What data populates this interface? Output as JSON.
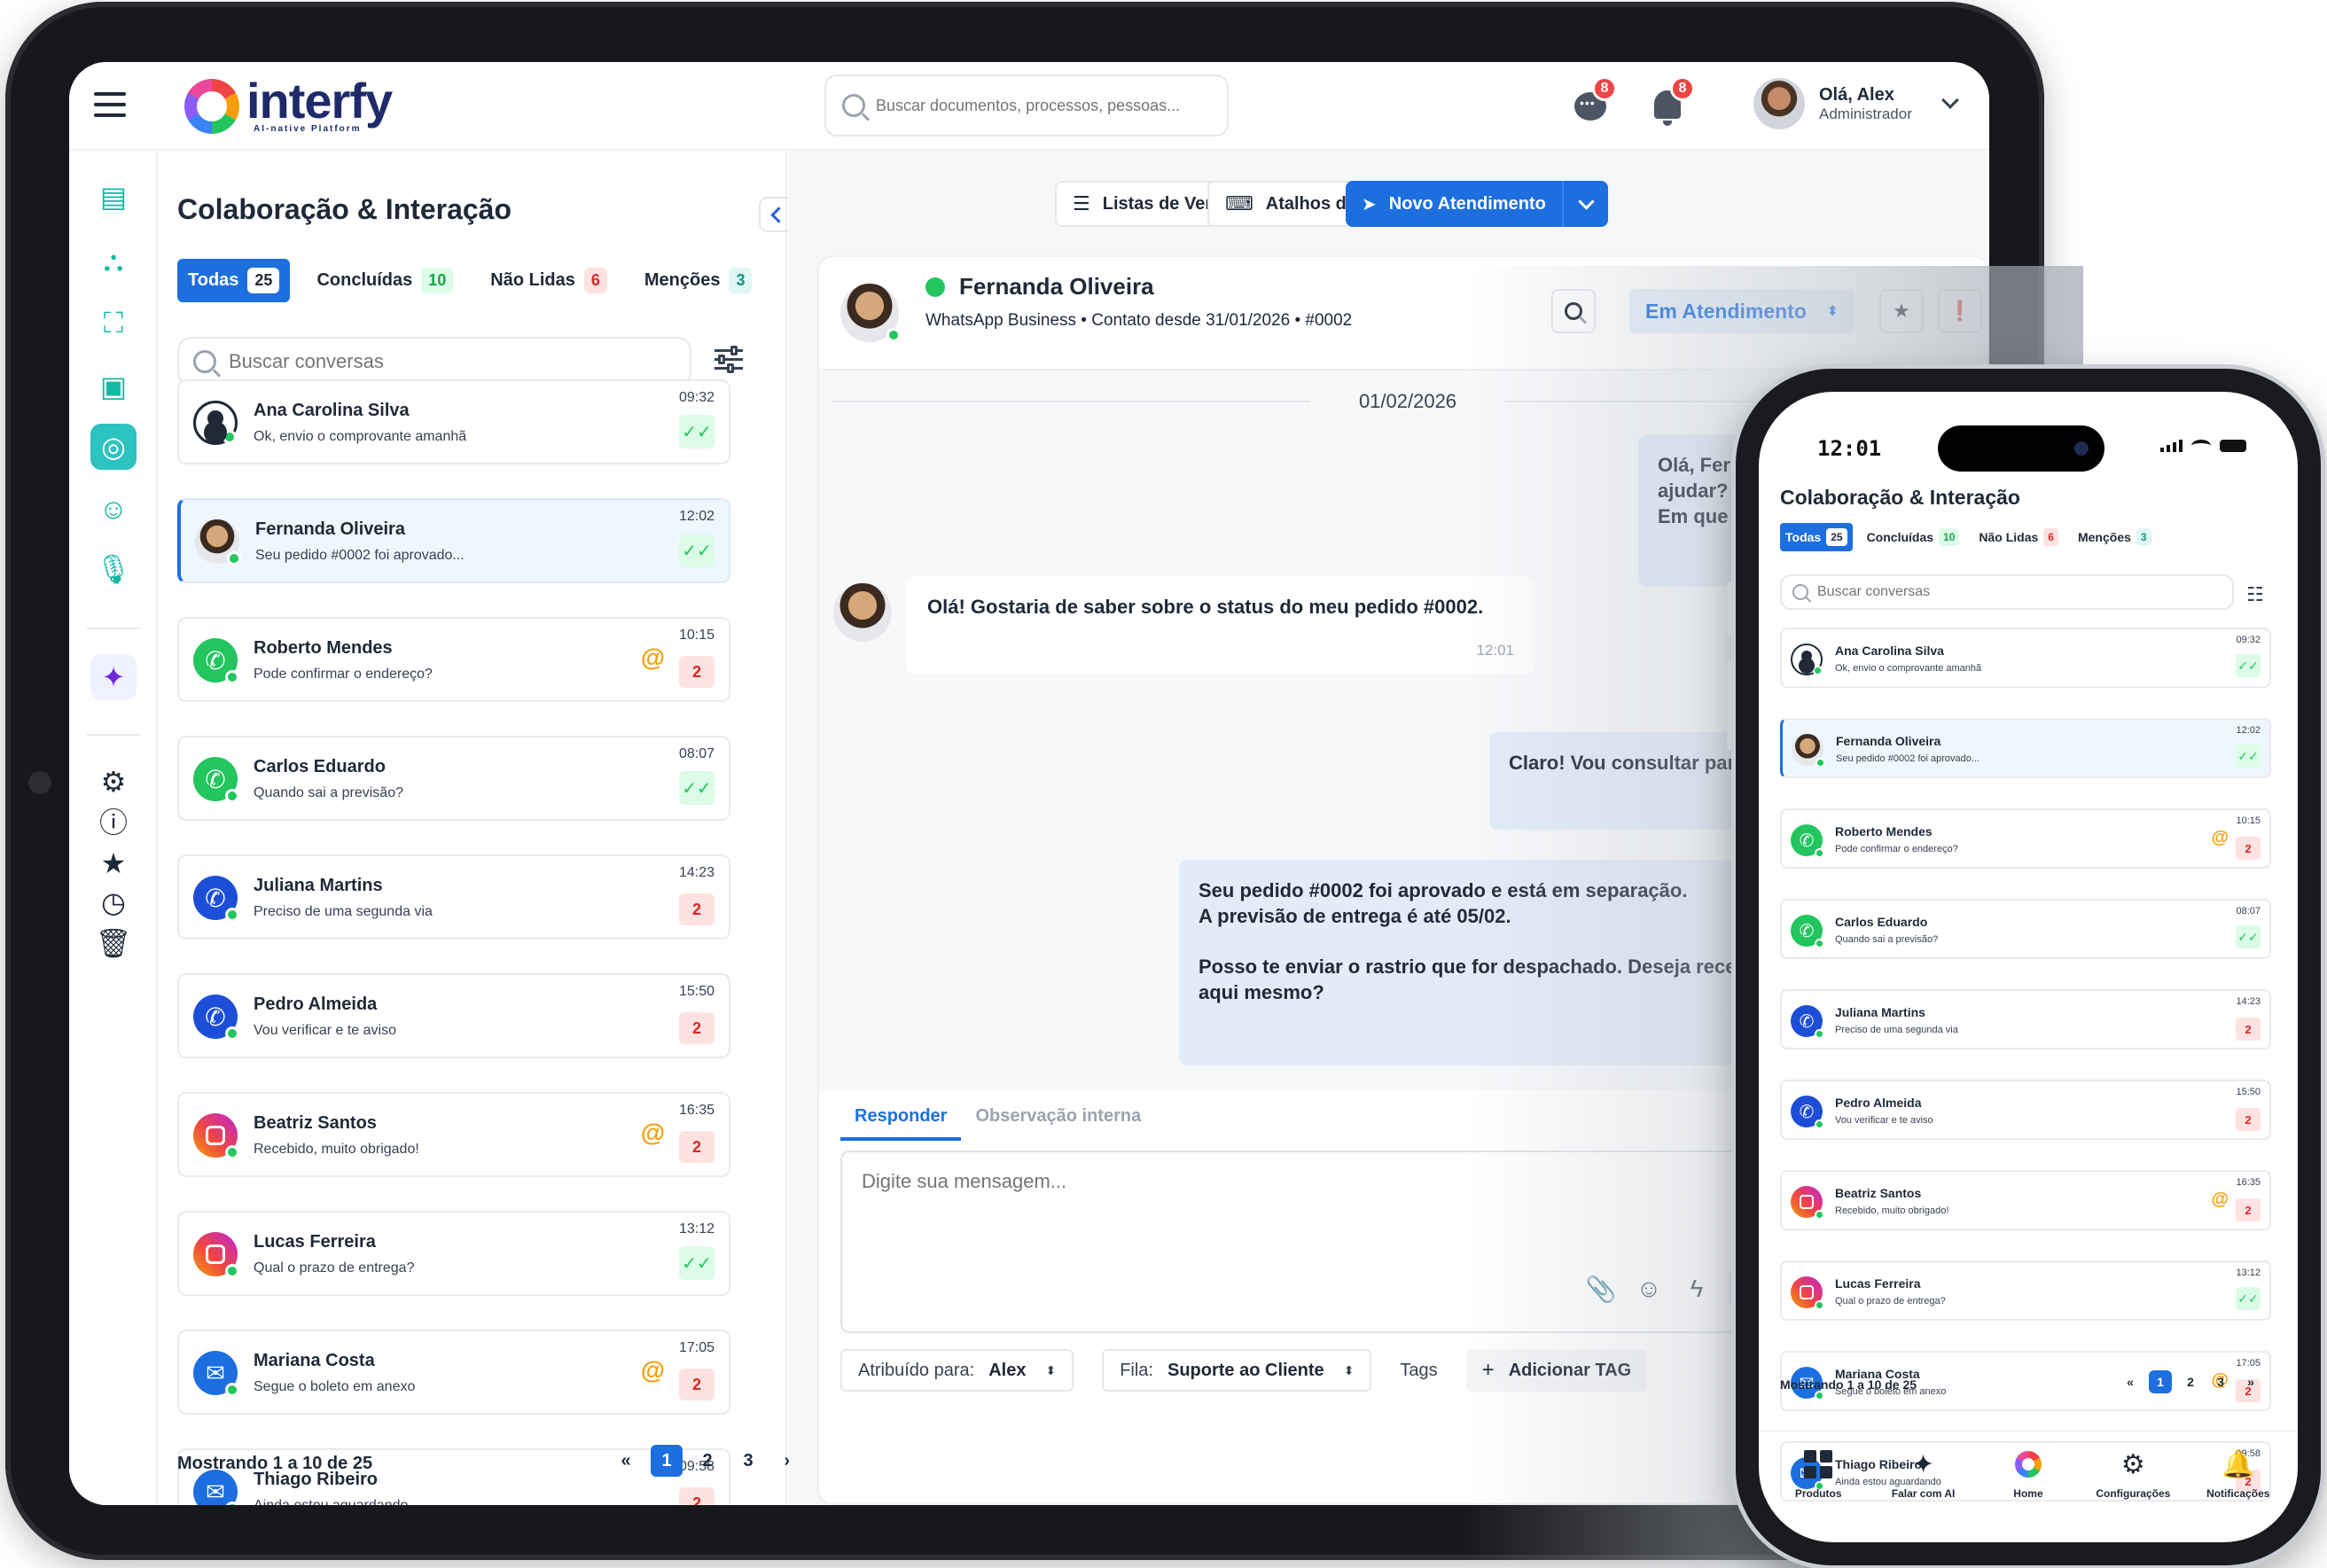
{
  "app": {
    "logo_name": "interfy",
    "logo_tagline": "AI-native Platform",
    "search_placeholder": "Buscar documentos, processos, pessoas...",
    "chat_badge": "8",
    "notif_badge": "8",
    "user_greeting": "Olá, Alex",
    "user_role": "Administrador"
  },
  "panel": {
    "title": "Colaboração & Interação",
    "tabs": [
      {
        "label": "Todas",
        "count": "25"
      },
      {
        "label": "Concluídas",
        "count": "10"
      },
      {
        "label": "Não Lidas",
        "count": "6"
      },
      {
        "label": "Menções",
        "count": "3"
      }
    ],
    "search_placeholder": "Buscar conversas",
    "conversations": [
      {
        "name": "Ana Carolina Silva",
        "message": "Ok, envio o comprovante amanhã",
        "time": "09:32",
        "channel": "user-icon",
        "status": "read",
        "check": "✓✓"
      },
      {
        "name": "Fernanda Oliveira",
        "message": "Seu pedido #0002 foi aprovado...",
        "time": "12:02",
        "channel": "photo",
        "status": "read",
        "check": "✓✓"
      },
      {
        "name": "Roberto Mendes",
        "message": "Pode confirmar o endereço?",
        "time": "10:15",
        "channel": "whatsapp-icon",
        "status": "unread",
        "unread": "2",
        "mention": "@"
      },
      {
        "name": "Carlos Eduardo",
        "message": "Quando sai a previsão?",
        "time": "08:07",
        "channel": "whatsapp-icon",
        "status": "read",
        "check": "✓✓"
      },
      {
        "name": "Juliana Martins",
        "message": "Preciso de uma segunda via",
        "time": "14:23",
        "channel": "phone-icon",
        "status": "unread",
        "unread": "2"
      },
      {
        "name": "Pedro Almeida",
        "message": "Vou verificar e te aviso",
        "time": "15:50",
        "channel": "phone-icon",
        "status": "unread",
        "unread": "2"
      },
      {
        "name": "Beatriz Santos",
        "message": "Recebido, muito obrigado!",
        "time": "16:35",
        "channel": "instagram-icon",
        "status": "unread",
        "unread": "2",
        "mention": "@"
      },
      {
        "name": "Lucas Ferreira",
        "message": "Qual o prazo de entrega?",
        "time": "13:12",
        "channel": "instagram-icon",
        "status": "read",
        "check": "✓✓"
      },
      {
        "name": "Mariana Costa",
        "message": "Segue o boleto em anexo",
        "time": "17:05",
        "channel": "mail-icon",
        "status": "unread",
        "unread": "2",
        "mention": "@"
      },
      {
        "name": "Thiago Ribeiro",
        "message": "Ainda estou aguardando",
        "time": "09:58",
        "channel": "mail-icon",
        "status": "unread",
        "unread": "2"
      }
    ],
    "pager_text": "Mostrando 1  a 10 de 25",
    "pager_first": "«",
    "pager_last": "»",
    "pages": [
      "1",
      "2",
      "3"
    ]
  },
  "toolbar": {
    "checklists": "Listas de Verificação",
    "shortcuts": "Atalhos do teclado",
    "new_ticket": "Novo Atendimento"
  },
  "chat": {
    "contact_name": "Fernanda Oliveira",
    "contact_meta": "WhatsApp Business  •  Contato desde 31/01/2026  •  #0002",
    "status": "Em Atendimento",
    "date": "01/02/2026",
    "messages": {
      "out1": "Olá, Fernanda! Como posso ajudar?\nEm que posso ajudar?",
      "in1_text": "Olá! Gostaria de saber sobre o status do meu pedido #0002.",
      "in1_time": "12:01",
      "out2": "Claro! Vou consultar para você.",
      "out3_line1": "Seu pedido #0002 foi aprovado e está em separação.",
      "out3_line2": "A previsão de entrega é até 05/02.",
      "out3_line3": "Posso te enviar o rastrio que for despachado. Deseja receber",
      "out3_line4": "aqui mesmo?"
    },
    "reply_tab": "Responder",
    "note_tab": "Observação interna",
    "composer_placeholder": "Digite sua mensagem...",
    "assigned_label": "Atribuído para:",
    "assigned_value": "Alex",
    "queue_label": "Fila:",
    "queue_value": "Suporte ao Cliente",
    "tags_label": "Tags",
    "add_tag": "Adicionar TAG"
  },
  "phone": {
    "time": "12:01",
    "pager_text": "Mostrando 1  a 10 de 25",
    "nav": [
      {
        "label": "Produtos",
        "icon": "grid-icon"
      },
      {
        "label": "Falar com AI",
        "icon": "sparkle-icon"
      },
      {
        "label": "Home",
        "icon": "logo-icon"
      },
      {
        "label": "Configurações",
        "icon": "settings-icon"
      },
      {
        "label": "Notificações",
        "icon": "bell-icon"
      }
    ]
  },
  "colors": {
    "primary": "#1d6fe0",
    "accent_teal": "#2cc3c0",
    "online": "#22c55e",
    "unread": "#dc2626",
    "mention": "#f59e0b"
  }
}
